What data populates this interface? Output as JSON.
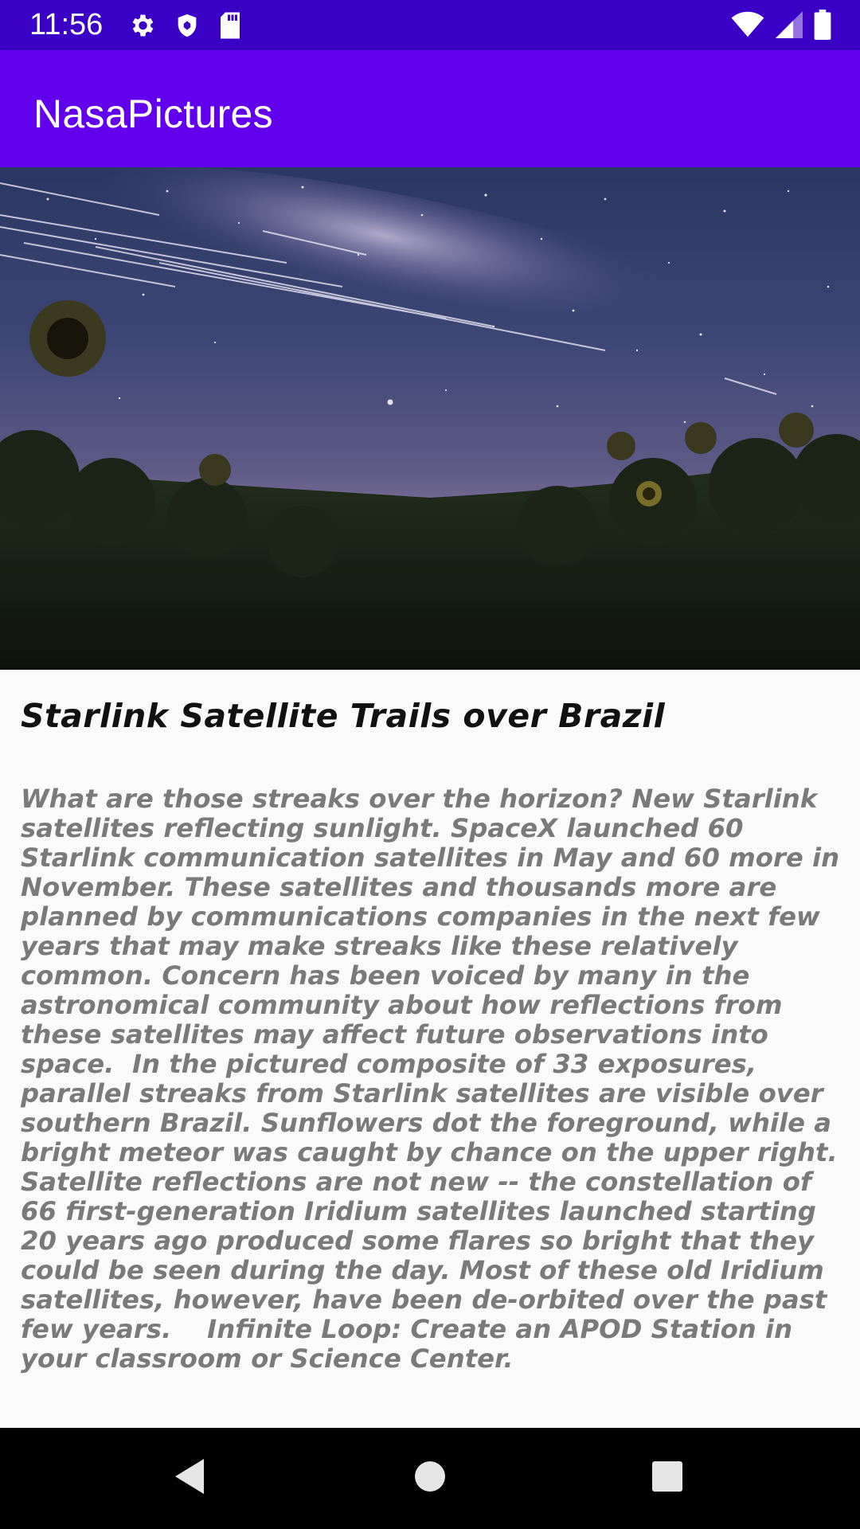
{
  "status_bar": {
    "time": "11:56",
    "left_icons": [
      "gear-icon",
      "shield-icon",
      "sd-card-icon"
    ],
    "right_icons": [
      "wifi-icon",
      "cell-signal-icon",
      "battery-icon"
    ],
    "background": "#3a00c5"
  },
  "app_bar": {
    "title": "NasaPictures",
    "background": "#6200ee"
  },
  "hero_image": {
    "description_icon": "starry-sky-sunflowers-image"
  },
  "article": {
    "title": "Starlink Satellite Trails over Brazil",
    "body": "What are those streaks over the horizon? New Starlink satellites reflecting sunlight. SpaceX launched 60 Starlink communication satellites in May and 60 more in November. These satellites and thousands more are planned by communications companies in the next few years that may make streaks like these relatively common. Concern has been voiced by many in the astronomical community about how reflections from these satellites may affect future observations into space.  In the pictured composite of 33 exposures, parallel streaks from Starlink satellites are visible over southern Brazil. Sunflowers dot the foreground, while a bright meteor was caught by chance on the upper right. Satellite reflections are not new -- the constellation of 66 first-generation Iridium satellites launched starting 20 years ago produced some flares so bright that they could be seen during the day. Most of these old Iridium satellites, however, have been de-orbited over the past few years.    Infinite Loop: Create an APOD Station in your classroom or Science Center."
  },
  "nav_bar": {
    "buttons": [
      "back-icon",
      "home-icon",
      "recents-icon"
    ]
  }
}
